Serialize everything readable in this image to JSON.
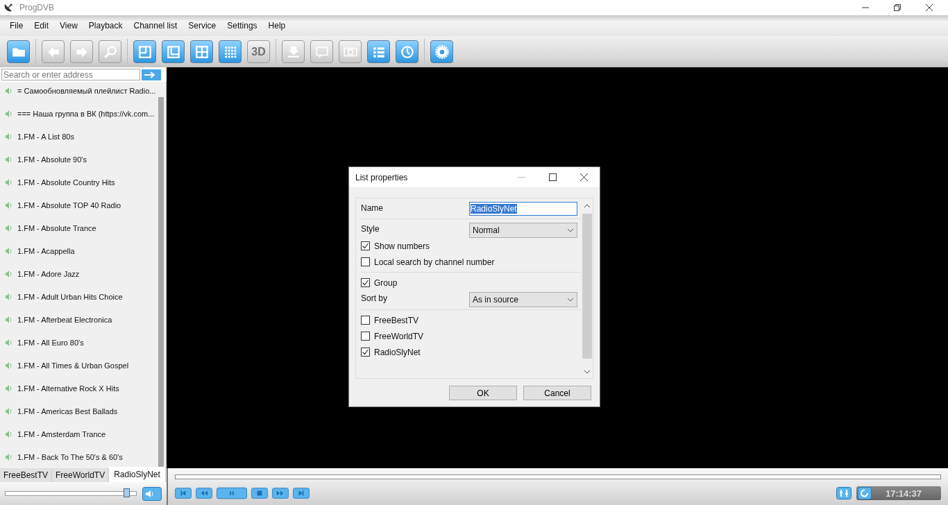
{
  "window": {
    "title": "ProgDVB"
  },
  "menu": [
    "File",
    "Edit",
    "View",
    "Playback",
    "Channel list",
    "Service",
    "Settings",
    "Help"
  ],
  "toolbar": [
    [
      {
        "kind": "folder",
        "disabled": false
      }
    ],
    [
      {
        "kind": "back",
        "disabled": true
      },
      {
        "kind": "forward",
        "disabled": true
      },
      {
        "kind": "zoom",
        "disabled": true
      }
    ],
    [
      {
        "kind": "window",
        "disabled": false
      },
      {
        "kind": "corner",
        "disabled": false
      },
      {
        "kind": "grid4",
        "disabled": false
      },
      {
        "kind": "grid16",
        "disabled": false
      },
      {
        "kind": "stereo",
        "disabled": true,
        "label": "3D"
      }
    ],
    [
      {
        "kind": "download",
        "disabled": true
      },
      {
        "kind": "text",
        "disabled": true
      },
      {
        "kind": "film",
        "disabled": true
      },
      {
        "kind": "list",
        "disabled": false
      },
      {
        "kind": "clock",
        "disabled": false
      }
    ],
    [
      {
        "kind": "gear",
        "disabled": false
      }
    ]
  ],
  "search": {
    "placeholder": "Search or enter address"
  },
  "channels": [
    "= Самообновляемый плейлист  Radio...",
    "=== Наша группа в ВК (https://vk.com...",
    "1.FM - A List 80s",
    "1.FM - Absolute 90's",
    "1.FM - Absolute Country Hits",
    "1.FM - Absolute TOP 40 Radio",
    "1.FM - Absolute Trance",
    "1.FM - Acappella",
    "1.FM - Adore Jazz",
    "1.FM - Adult Urban Hits Choice",
    "1.FM - Afterbeat Electronica",
    "1.FM - All Euro 80's",
    "1.FM - All Times & Urban Gospel",
    "1.FM - Alternative Rock X Hits",
    "1.FM - Americas Best Ballads",
    "1.FM - Amsterdam Trance",
    "1.FM - Back To The 50's & 60's"
  ],
  "list_tabs": [
    {
      "label": "FreeBestTV",
      "selected": false
    },
    {
      "label": "FreeWorldTV",
      "selected": false
    },
    {
      "label": "RadioSlyNet",
      "selected": true
    }
  ],
  "volume": {
    "level": 0.95
  },
  "player_controls": [
    {
      "kind": "first"
    },
    {
      "kind": "rewind"
    },
    {
      "kind": "pause"
    },
    {
      "kind": "stop"
    },
    {
      "kind": "forward"
    },
    {
      "kind": "last"
    }
  ],
  "progress": {
    "level": 0
  },
  "clock": "17:14:37",
  "dialog": {
    "title": "List properties",
    "sections": [
      [
        {
          "kind": "text",
          "label": "Name",
          "value": "RadioSlyNet"
        }
      ],
      [
        {
          "kind": "select",
          "label": "Style",
          "value": "Normal"
        },
        {
          "kind": "checkbox",
          "label": "Show numbers",
          "checked": true
        },
        {
          "kind": "checkbox",
          "label": "Local search by channel number",
          "checked": false
        }
      ],
      [
        {
          "kind": "checkbox",
          "label": "Group",
          "checked": true
        },
        {
          "kind": "select",
          "label": "Sort by",
          "value": "As in source"
        }
      ],
      [
        {
          "kind": "checkbox",
          "label": "FreeBestTV",
          "checked": false
        },
        {
          "kind": "checkbox",
          "label": "FreeWorldTV",
          "checked": false
        },
        {
          "kind": "checkbox",
          "label": "RadioSlyNet",
          "checked": true
        }
      ]
    ],
    "buttons": [
      "OK",
      "Cancel"
    ]
  }
}
